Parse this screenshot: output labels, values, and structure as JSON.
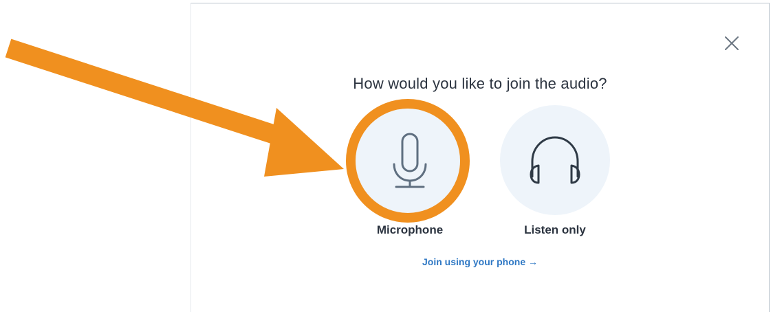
{
  "dialog": {
    "title": "How would you like to join the audio?",
    "close_icon": "close-icon",
    "options": [
      {
        "label": "Microphone",
        "icon": "microphone-icon",
        "highlighted": true
      },
      {
        "label": "Listen only",
        "icon": "headphones-icon",
        "highlighted": false
      }
    ],
    "phone_link": "Join using your phone →"
  },
  "colors": {
    "accent": "#2f78c4",
    "option_background": "#eef4fa",
    "icon_stroke": "#5f6f80",
    "text": "#2c3440",
    "annotation": "#f0901f"
  }
}
